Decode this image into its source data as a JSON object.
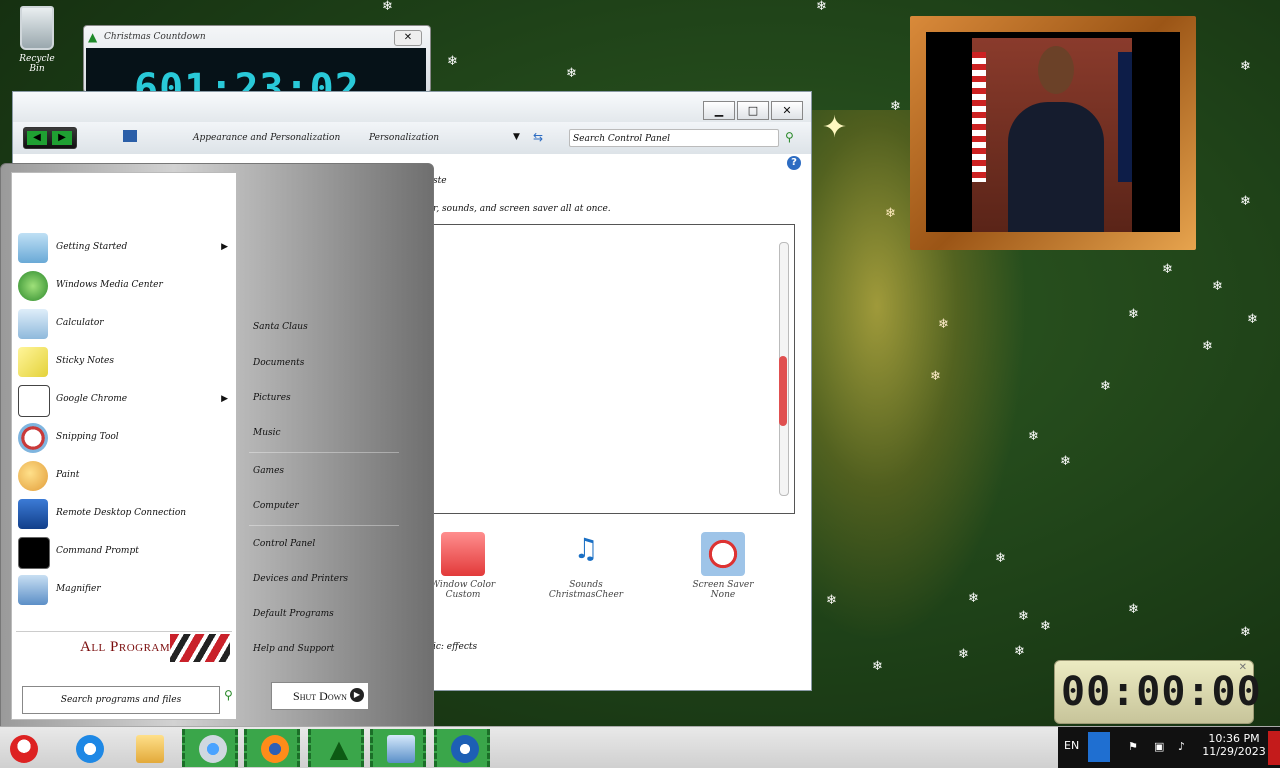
{
  "desktop": {
    "recycle_bin_label": "Recycle Bin",
    "snowflake_glyph": "❄"
  },
  "countdown_widget": {
    "title": "Christmas Countdown",
    "display": "601:23:02",
    "close_glyph": "✕"
  },
  "clock_widget": {
    "display": "00:00:00",
    "close_glyph": "✕"
  },
  "control_panel": {
    "nav_back": "◀",
    "nav_forward": "▶",
    "breadcrumb": [
      "Appearance and Personalization",
      "Personalization"
    ],
    "search_placeholder": "Search Control Panel",
    "header_text": "ste",
    "description": "r, sounds, and screen saver all at once.",
    "items": [
      {
        "label": "Window Color",
        "sublabel": "Custom"
      },
      {
        "label": "Sounds",
        "sublabel": "ChristmasCheer"
      },
      {
        "label": "Screen Saver",
        "sublabel": "None"
      }
    ],
    "footer_text": "ic: effects",
    "help": "?",
    "buttons": {
      "minimize": "▁",
      "maximize": "□",
      "close": "✕"
    }
  },
  "start_menu": {
    "programs": [
      {
        "label": "Getting Started",
        "submenu": true
      },
      {
        "label": "Windows Media Center",
        "submenu": false
      },
      {
        "label": "Calculator",
        "submenu": false
      },
      {
        "label": "Sticky Notes",
        "submenu": false
      },
      {
        "label": "Google Chrome",
        "submenu": true
      },
      {
        "label": "Snipping Tool",
        "submenu": false
      },
      {
        "label": "Paint",
        "submenu": false
      },
      {
        "label": "Remote Desktop Connection",
        "submenu": false
      },
      {
        "label": "Command Prompt",
        "submenu": false
      },
      {
        "label": "Magnifier",
        "submenu": false
      }
    ],
    "all_programs_label": "All Programs",
    "search_placeholder": "Search programs and files",
    "right_items": [
      "Santa Claus",
      "Documents",
      "Pictures",
      "Music",
      "Games",
      "Computer",
      "Control Panel",
      "Devices and Printers",
      "Default Programs",
      "Help and Support"
    ],
    "shutdown_label": "Shut Down",
    "submenu_arrow": "▶"
  },
  "taskbar": {
    "language": "EN",
    "time": "10:36 PM",
    "date": "11/29/2023",
    "icons": [
      "santa-start-icon",
      "internet-explorer-icon",
      "explorer-folder-icon",
      "chrome-icon",
      "firefox-icon",
      "christmas-tree-icon",
      "control-panel-icon",
      "thunderbird-icon"
    ],
    "colors": {
      "active_highlight": "#3aa64a",
      "tray_bg": "#111111"
    }
  }
}
